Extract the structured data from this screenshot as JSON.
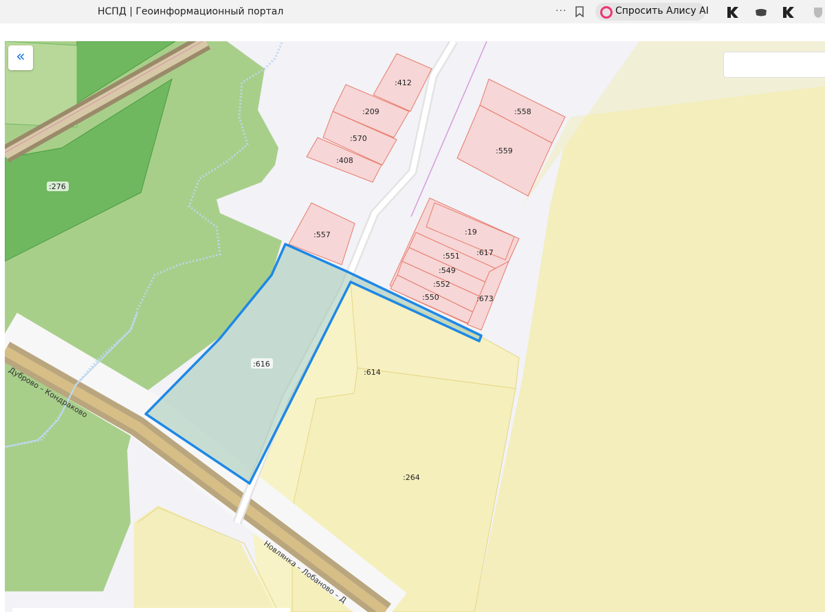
{
  "browser": {
    "tab_title": "НСПД | Геоинформационный портал",
    "more_glyph": "···",
    "alice_label": "Спросить Алису AI",
    "icons": [
      "bookmark-icon",
      "alice-icon",
      "kinopoisk-icon",
      "shield-icon",
      "kinopoisk-icon",
      "shield-icon"
    ]
  },
  "map": {
    "collapse_glyph": "«",
    "search_placeholder": "",
    "road_labels": {
      "west": "Дуброво – Кондраково",
      "south": "Новлянка – Лобаново – Д"
    },
    "parcels": [
      {
        "id": "276",
        "label": ":276"
      },
      {
        "id": "412",
        "label": ":412"
      },
      {
        "id": "209",
        "label": ":209"
      },
      {
        "id": "570",
        "label": ":570"
      },
      {
        "id": "408",
        "label": ":408"
      },
      {
        "id": "558",
        "label": ":558"
      },
      {
        "id": "559",
        "label": ":559"
      },
      {
        "id": "557",
        "label": ":557"
      },
      {
        "id": "19",
        "label": ":19"
      },
      {
        "id": "617",
        "label": ":617"
      },
      {
        "id": "551",
        "label": ":551"
      },
      {
        "id": "549",
        "label": ":549"
      },
      {
        "id": "552",
        "label": ":552"
      },
      {
        "id": "550",
        "label": ":550"
      },
      {
        "id": "673",
        "label": ":673"
      },
      {
        "id": "616",
        "label": ":616",
        "selected": true
      },
      {
        "id": "614",
        "label": ":614"
      },
      {
        "id": "264",
        "label": ":264"
      }
    ],
    "colors": {
      "forest": "#a8cf8a",
      "forest_dark": "#6fb85f",
      "agri": "#f5f0c0",
      "settlement": "#f2f2f7",
      "building_fill": "#f6d6d6",
      "building_stroke": "#e8796a",
      "selected_stroke": "#1e88e5",
      "road": "#c9b58a"
    }
  }
}
